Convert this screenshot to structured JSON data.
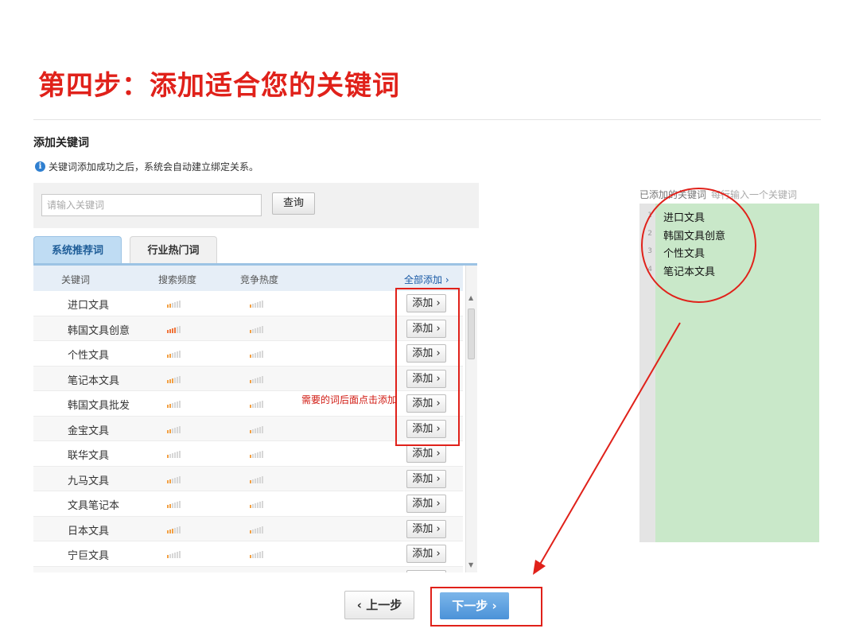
{
  "slide_title": "第四步：添加适合您的关键词",
  "section_title": "添加关键词",
  "notice": "关键词添加成功之后，系统会自动建立绑定关系。",
  "search": {
    "placeholder": "请输入关键词",
    "button": "查询"
  },
  "tabs": [
    {
      "label": "系统推荐词",
      "active": true
    },
    {
      "label": "行业热门词",
      "active": false
    }
  ],
  "table": {
    "headers": {
      "keyword": "关键词",
      "search_freq": "搜索频度",
      "competition": "竞争热度",
      "add_all": "全部添加 ›"
    },
    "add_label": "添加 ›",
    "rows": [
      {
        "keyword": "进口文具",
        "freq": 2,
        "comp": 1
      },
      {
        "keyword": "韩国文具创意",
        "freq": 4,
        "comp": 1
      },
      {
        "keyword": "个性文具",
        "freq": 2,
        "comp": 1
      },
      {
        "keyword": "笔记本文具",
        "freq": 3,
        "comp": 1
      },
      {
        "keyword": "韩国文具批发",
        "freq": 2,
        "comp": 1
      },
      {
        "keyword": "金宝文具",
        "freq": 2,
        "comp": 1
      },
      {
        "keyword": "联华文具",
        "freq": 1,
        "comp": 1
      },
      {
        "keyword": "九马文具",
        "freq": 2,
        "comp": 1
      },
      {
        "keyword": "文具笔记本",
        "freq": 2,
        "comp": 1
      },
      {
        "keyword": "日本文具",
        "freq": 3,
        "comp": 1
      },
      {
        "keyword": "宁巨文具",
        "freq": 1,
        "comp": 1
      },
      {
        "keyword": "",
        "freq": 1,
        "comp": 1
      }
    ]
  },
  "annotation": "需要的词后面点击添加",
  "added_panel": {
    "label": "已添加的关键词",
    "hint": "每行输入一个关键词",
    "line_numbers": [
      "1",
      "2",
      "3",
      "4"
    ],
    "keywords": [
      "进口文具",
      "韩国文具创意",
      "个性文具",
      "笔记本文具"
    ]
  },
  "nav": {
    "prev": "‹ 上一步",
    "next": "下一步 ›"
  },
  "colors": {
    "title_red": "#e0211a",
    "tab_active": "#bfdcf3",
    "editor_green": "#c9e8c9",
    "next_blue": "#4b92d8",
    "bar_on": "#f2a043"
  }
}
